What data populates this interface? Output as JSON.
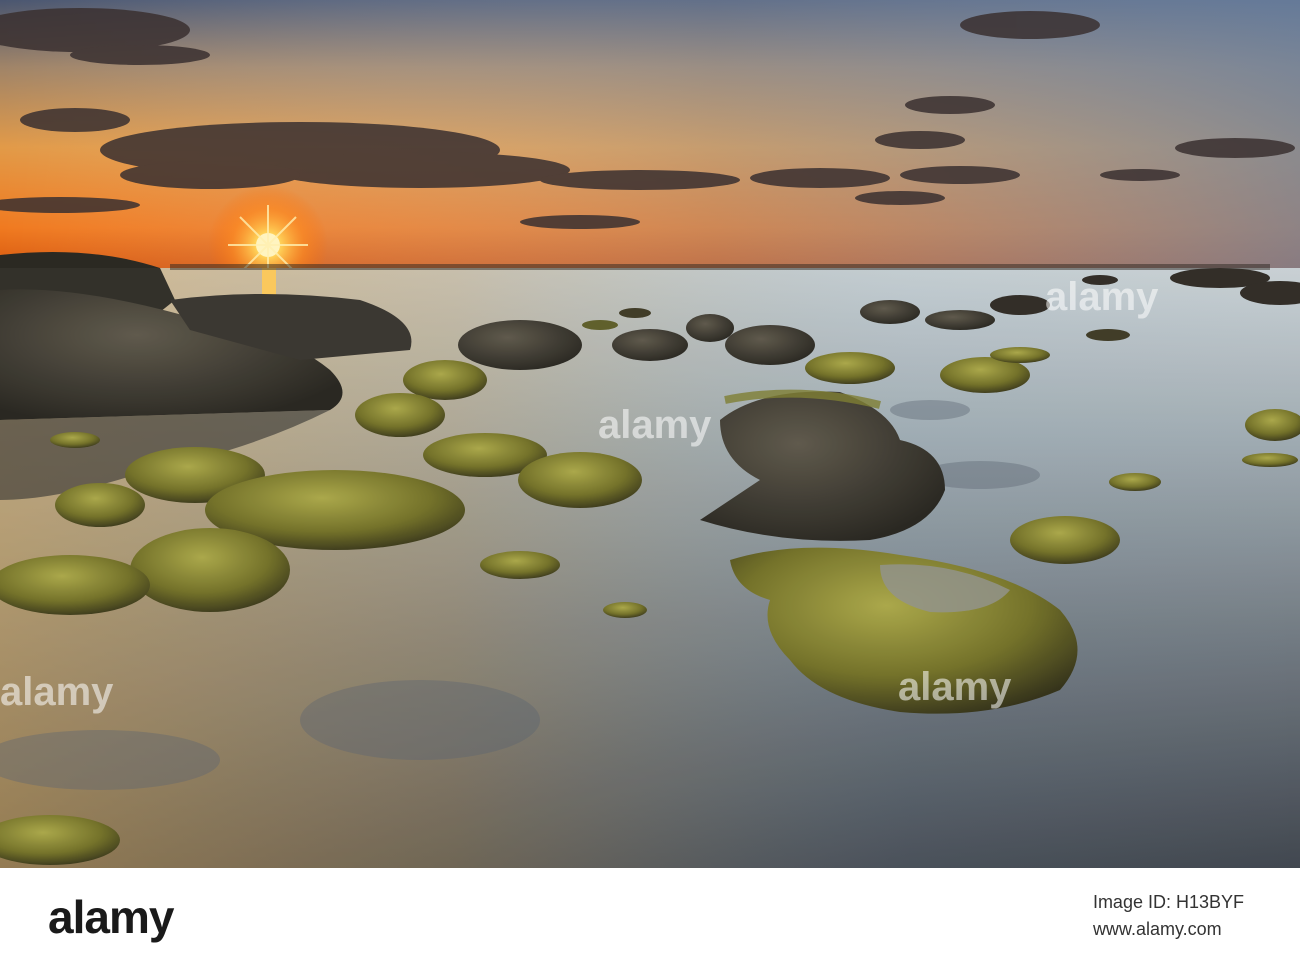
{
  "photo": {
    "scene": "sunset over rocky tidal flat with seaweed-covered rocks reflecting in calm water",
    "colors": {
      "sky_top": "#3b4a66",
      "sky_mid": "#d98a3a",
      "sun": "#ffe07a",
      "horizon": "#ff7a1a",
      "water_light": "#c6d3dc",
      "water_dark": "#2c3440",
      "rock": "#2b2a22",
      "seaweed": "#8b8a2c"
    },
    "watermark_text": "alamy"
  },
  "footer": {
    "logo": "alamy",
    "image_id_label": "Image ID: H13BYF",
    "site": "www.alamy.com"
  }
}
